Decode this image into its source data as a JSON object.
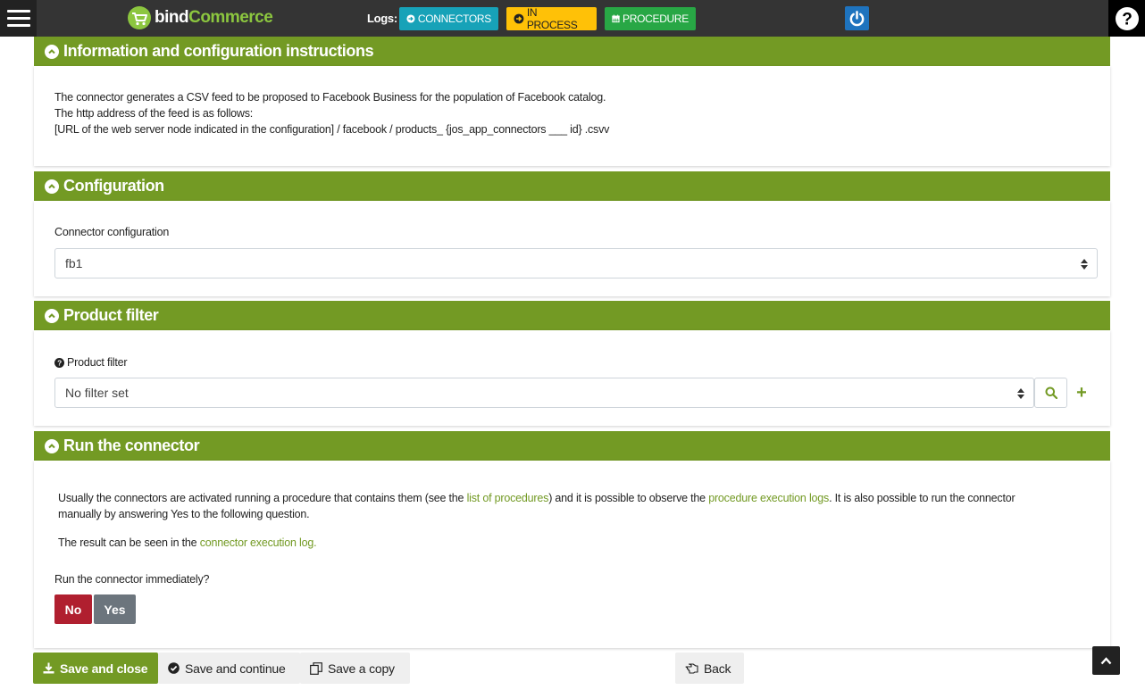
{
  "topbar": {
    "logo_part1": "bind",
    "logo_part2": "Commerce",
    "logs_label": "Logs:",
    "connectors_label": "CONNECTORS",
    "inprocess_label": "IN PROCESS",
    "procedure_label": "PROCEDURE",
    "help_label": "?"
  },
  "info_panel": {
    "title": "Information and configuration instructions",
    "lines": [
      "The connector generates a CSV feed to be proposed to Facebook Business for the population of Facebook catalog.",
      "The http address of the feed is as follows:",
      "[URL of the web server node indicated in the configuration] / facebook / products_ {jos_app_connectors ___ id} .csvv"
    ]
  },
  "config_panel": {
    "title": "Configuration",
    "field_label": "Connector configuration",
    "selected_value": "fb1"
  },
  "filter_panel": {
    "title": "Product filter",
    "field_label": "Product filter",
    "selected_value": "No filter set",
    "add_label": "+"
  },
  "run_panel": {
    "title": "Run the connector",
    "para1_a": "Usually the connectors are activated running a procedure that contains them (see the ",
    "para1_link1": "list of procedures",
    "para1_b": ") and it is possible to observe the ",
    "para1_link2": "procedure execution logs",
    "para1_c": ". It is also possible to run the connector",
    "para1_d": "manually by answering Yes to the following question.",
    "para2_a": "The result can be seen in the ",
    "para2_link": "connector execution log.",
    "question": "Run the connector immediately?",
    "no_label": "No",
    "yes_label": "Yes"
  },
  "toolbar": {
    "save_close_label": "Save and close",
    "save_continue_label": "Save and continue",
    "save_copy_label": "Save a copy",
    "back_label": "Back"
  },
  "colors": {
    "accent_green": "#739a24",
    "topbar": "#343434",
    "connectors": "#17a2b8",
    "inprocess": "#ffc107",
    "procedure": "#28a745",
    "no_red": "#b01f2f",
    "yes_gray": "#6c757d"
  }
}
